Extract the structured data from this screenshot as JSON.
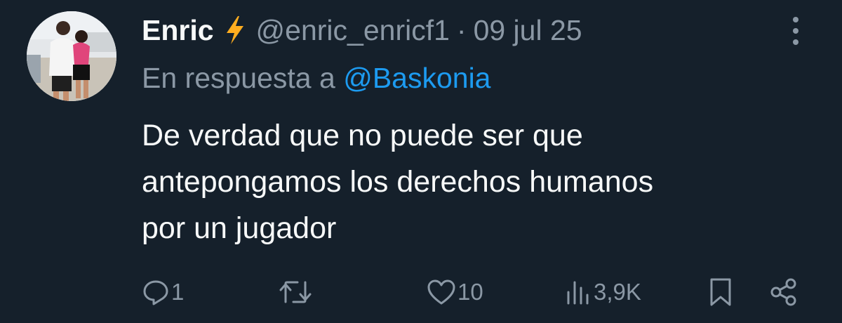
{
  "tweet": {
    "display_name": "Enric",
    "verified_icon": "lightning-bolt-icon",
    "handle": "@enric_enricf1",
    "separator": "·",
    "date": "09 jul 25",
    "reply_prefix": "En respuesta a",
    "reply_to": "@Baskonia",
    "text_lines": [
      "De verdad que no puede ser que",
      "antepongamos los derechos humanos",
      "por un jugador"
    ]
  },
  "actions": {
    "replies": "1",
    "retweets": "",
    "likes": "10",
    "views": "3,9K"
  },
  "colors": {
    "background": "#15202b",
    "text": "#f7f9f9",
    "muted": "#8b98a5",
    "link": "#1d9bf0",
    "bolt": "#ffad1f"
  }
}
